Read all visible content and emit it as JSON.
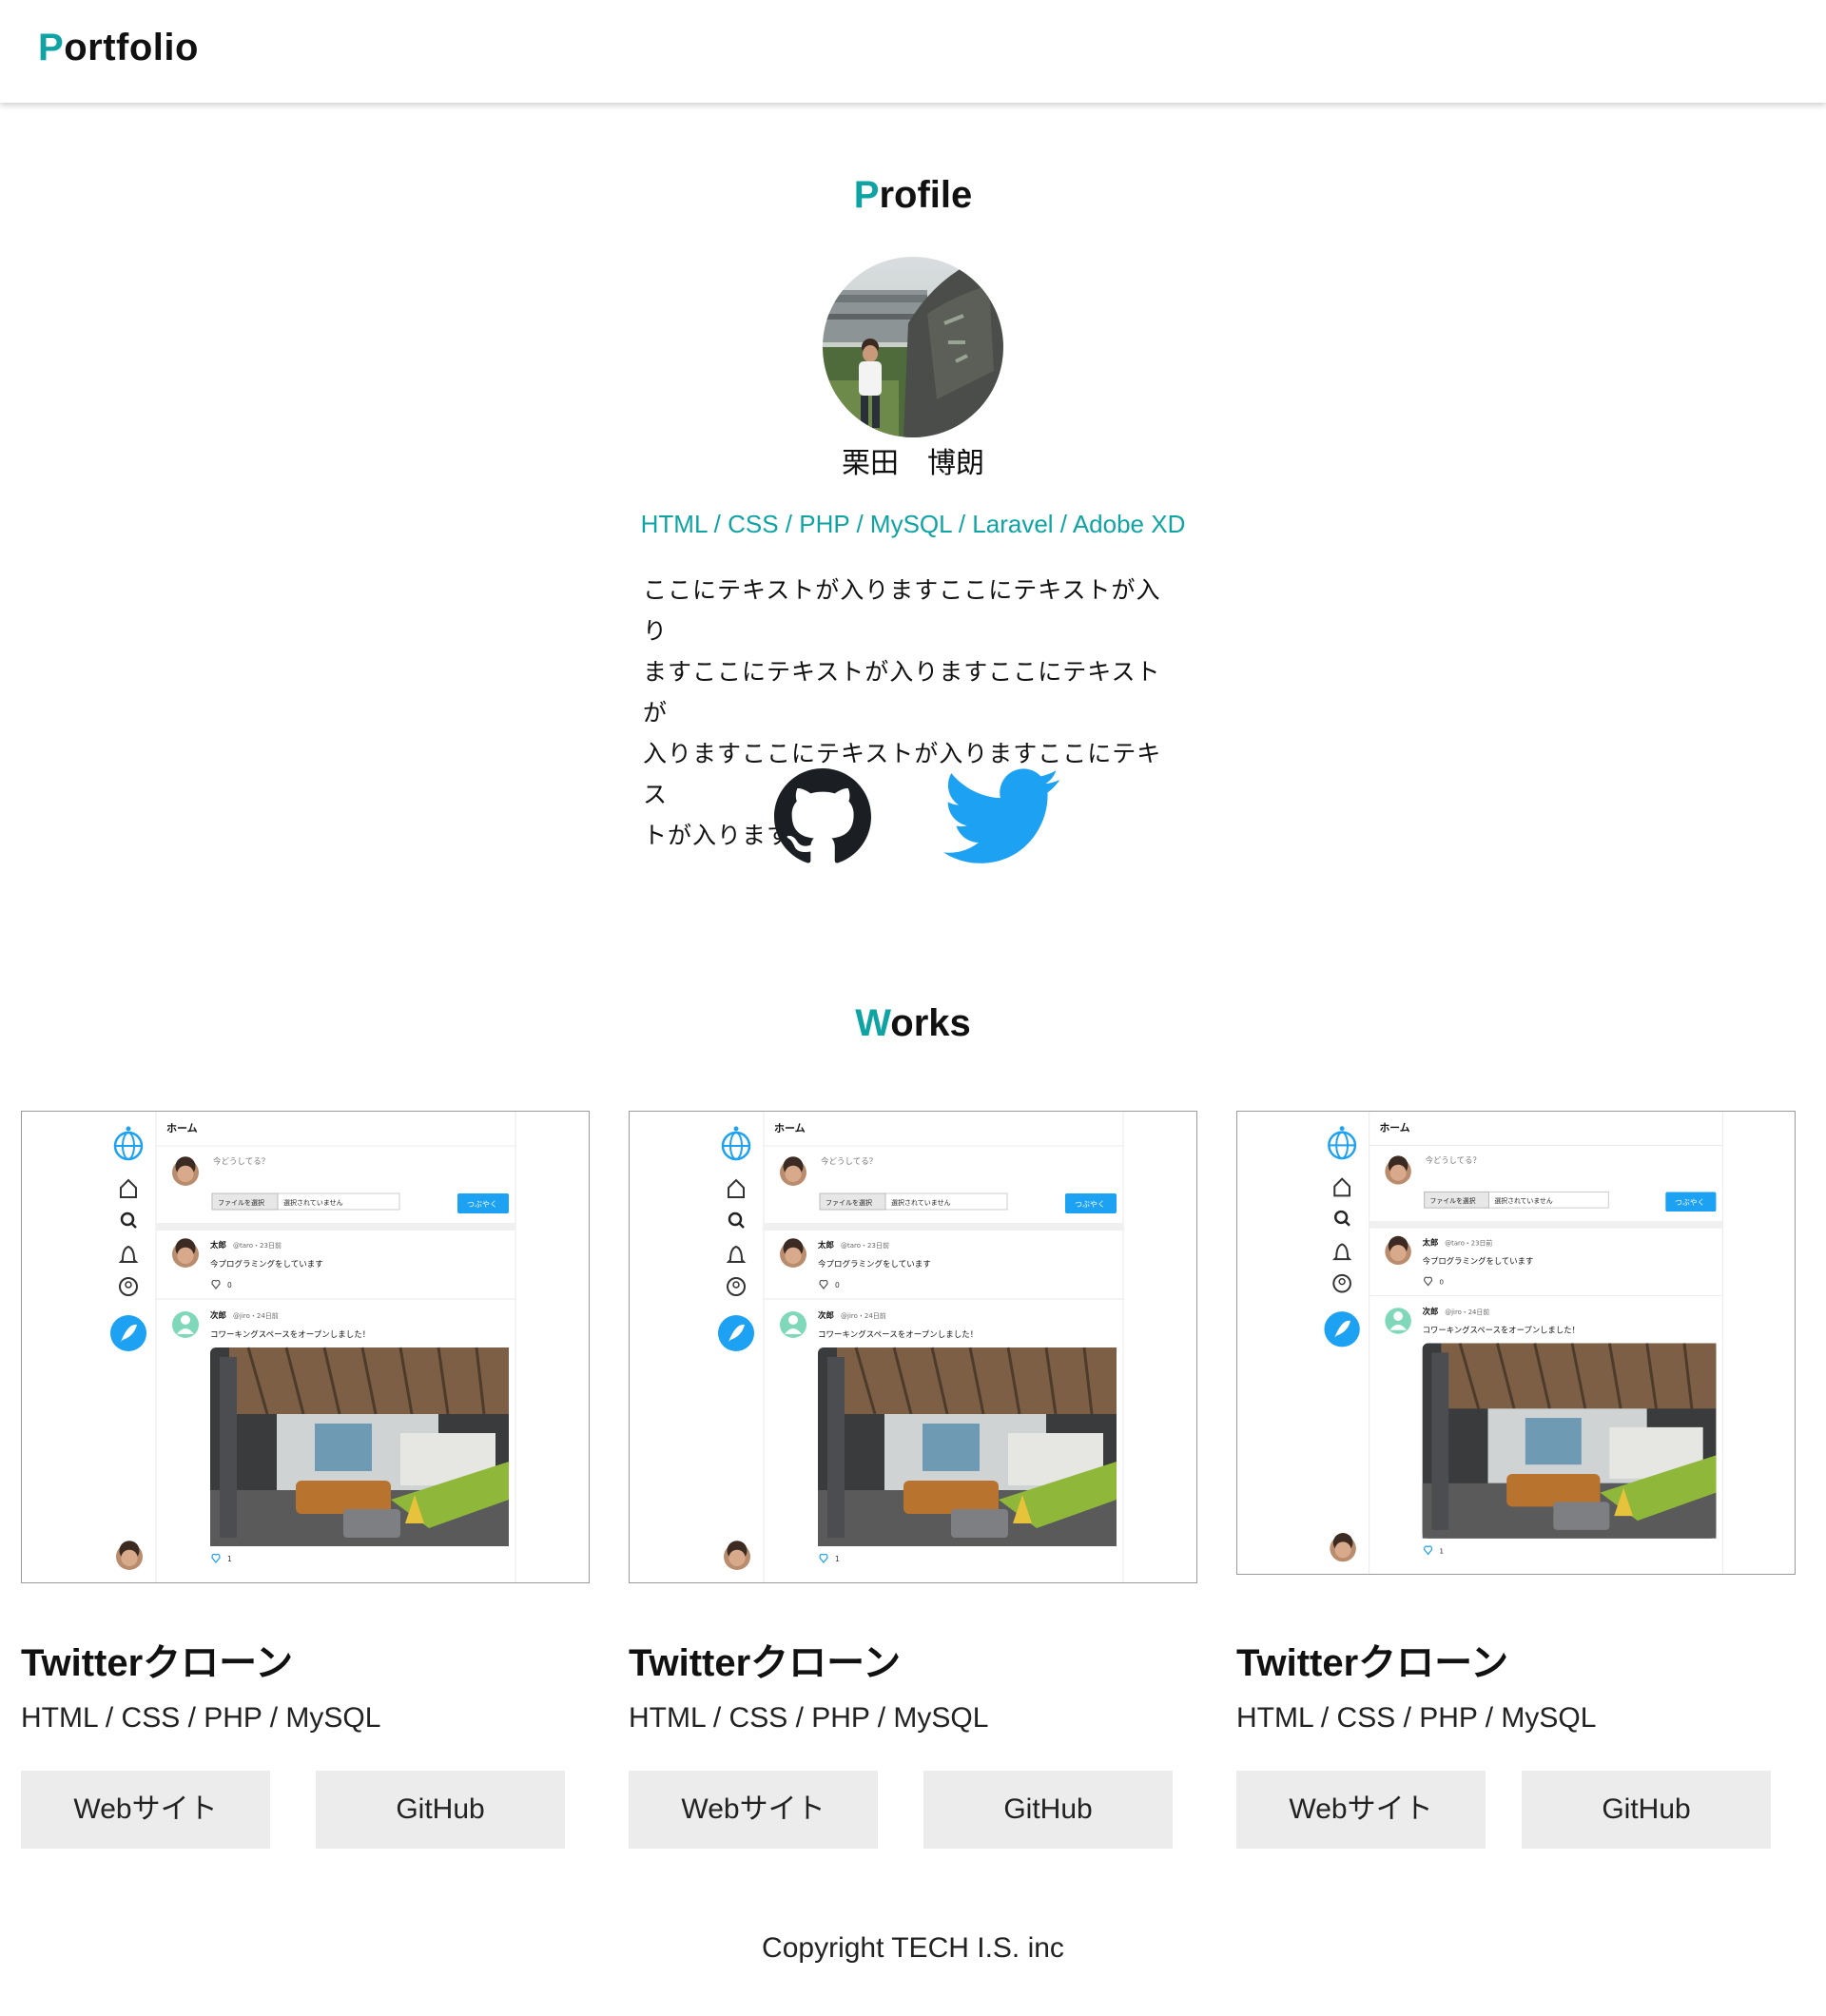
{
  "header": {
    "logo_first": "P",
    "logo_rest": "ortfolio"
  },
  "profile": {
    "title_first": "P",
    "title_rest": "rofile",
    "name": "栗田　博朗",
    "skills": "HTML / CSS / PHP / MySQL / Laravel / Adobe XD",
    "bio_lines": [
      "ここにテキストが入りますここにテキストが入り",
      "ますここにテキストが入りますここにテキストが",
      "入りますここにテキストが入りますここにテキス",
      "トが入ります"
    ]
  },
  "works": {
    "title_first": "W",
    "title_rest": "orks",
    "items": [
      {
        "title": "Twitterクローン",
        "tech": "HTML / CSS / PHP / MySQL",
        "web_label": "Webサイト",
        "github_label": "GitHub"
      },
      {
        "title": "Twitterクローン",
        "tech": "HTML / CSS / PHP / MySQL",
        "web_label": "Webサイト",
        "github_label": "GitHub"
      },
      {
        "title": "Twitterクローン",
        "tech": "HTML / CSS / PHP / MySQL",
        "web_label": "Webサイト",
        "github_label": "GitHub"
      }
    ],
    "mock": {
      "home": "ホーム",
      "placeholder": "今どうしてる？",
      "file_button": "ファイルを選択",
      "file_status": "選択されていません",
      "tweet_button": "つぶやく",
      "tweet1_name": "太郎",
      "tweet1_meta": "@taro・23日前",
      "tweet1_text": "今プログラミングをしています",
      "tweet1_likes": "0",
      "tweet2_name": "次郎",
      "tweet2_meta": "@jiro・24日前",
      "tweet2_text": "コワーキングスペースをオープンしました！",
      "tweet2_likes": "1"
    }
  },
  "footer": {
    "copyright": "Copyright TECH I.S. inc"
  },
  "colors": {
    "accent": "#0fa3a3",
    "twitter": "#1da1f2",
    "github": "#1b1f23",
    "button_bg": "#ececec"
  }
}
